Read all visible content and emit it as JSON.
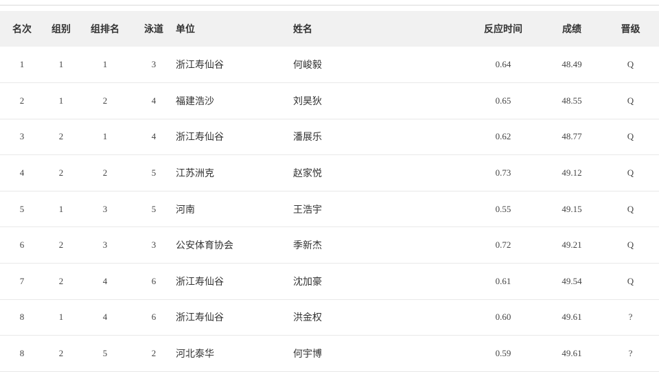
{
  "table": {
    "headers": {
      "rank": "名次",
      "group": "组别",
      "group_rank": "组排名",
      "lane": "泳道",
      "unit": "单位",
      "name": "姓名",
      "reaction": "反应时间",
      "score": "成绩",
      "advance": "晋级"
    },
    "rows": [
      {
        "rank": "1",
        "group": "1",
        "group_rank": "1",
        "lane": "3",
        "unit": "浙江寿仙谷",
        "name": "何峻毅",
        "reaction": "0.64",
        "score": "48.49",
        "advance": "Q"
      },
      {
        "rank": "2",
        "group": "1",
        "group_rank": "2",
        "lane": "4",
        "unit": "福建浩沙",
        "name": "刘昊狄",
        "reaction": "0.65",
        "score": "48.55",
        "advance": "Q"
      },
      {
        "rank": "3",
        "group": "2",
        "group_rank": "1",
        "lane": "4",
        "unit": "浙江寿仙谷",
        "name": "潘展乐",
        "reaction": "0.62",
        "score": "48.77",
        "advance": "Q"
      },
      {
        "rank": "4",
        "group": "2",
        "group_rank": "2",
        "lane": "5",
        "unit": "江苏洲克",
        "name": "赵家悦",
        "reaction": "0.73",
        "score": "49.12",
        "advance": "Q"
      },
      {
        "rank": "5",
        "group": "1",
        "group_rank": "3",
        "lane": "5",
        "unit": "河南",
        "name": "王浩宇",
        "reaction": "0.55",
        "score": "49.15",
        "advance": "Q"
      },
      {
        "rank": "6",
        "group": "2",
        "group_rank": "3",
        "lane": "3",
        "unit": "公安体育协会",
        "name": "季新杰",
        "reaction": "0.72",
        "score": "49.21",
        "advance": "Q"
      },
      {
        "rank": "7",
        "group": "2",
        "group_rank": "4",
        "lane": "6",
        "unit": "浙江寿仙谷",
        "name": "沈加豪",
        "reaction": "0.61",
        "score": "49.54",
        "advance": "Q"
      },
      {
        "rank": "8",
        "group": "1",
        "group_rank": "4",
        "lane": "6",
        "unit": "浙江寿仙谷",
        "name": "洪金权",
        "reaction": "0.60",
        "score": "49.61",
        "advance": "?"
      },
      {
        "rank": "8",
        "group": "2",
        "group_rank": "5",
        "lane": "2",
        "unit": "河北泰华",
        "name": "何宇博",
        "reaction": "0.59",
        "score": "49.61",
        "advance": "?"
      }
    ]
  }
}
